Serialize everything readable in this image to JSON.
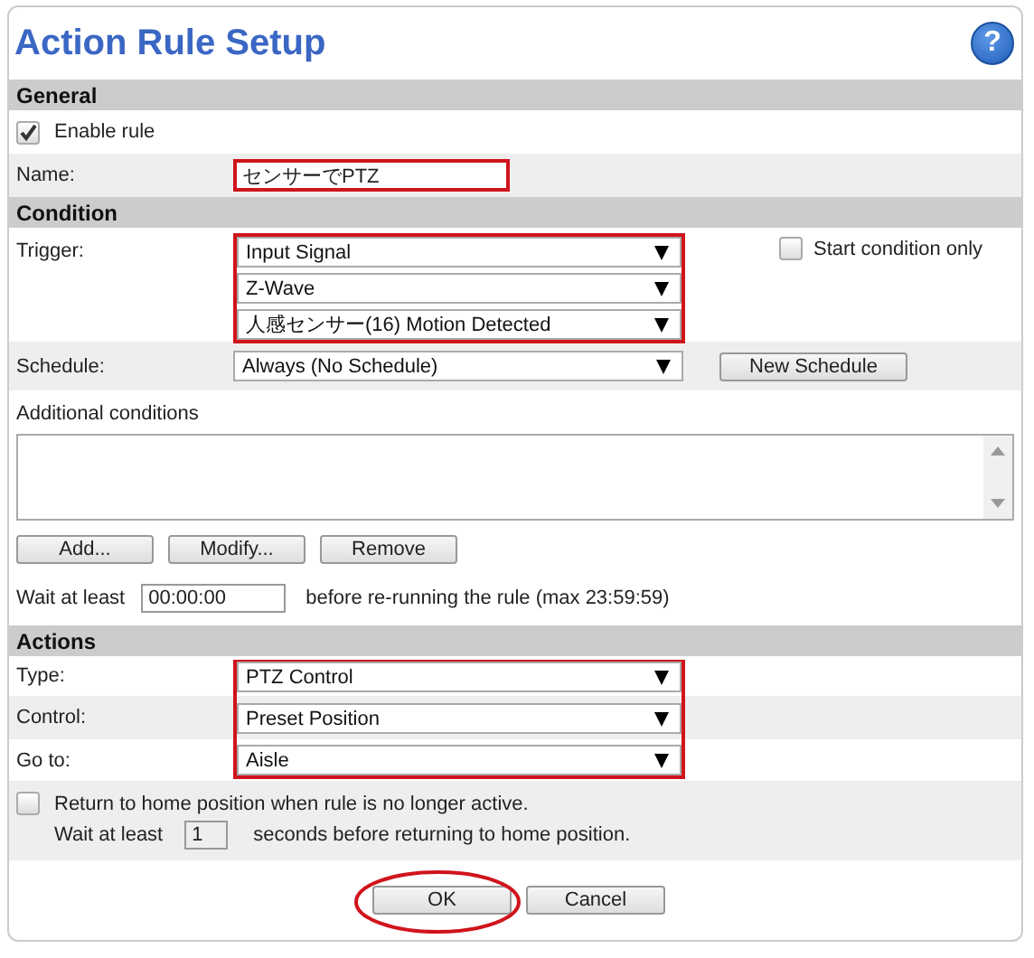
{
  "title": "Action Rule Setup",
  "help_icon": "?",
  "general": {
    "heading": "General",
    "enable_rule": {
      "label": "Enable rule",
      "checked": true
    },
    "name": {
      "label": "Name:",
      "value": "センサーでPTZ",
      "highlighted": true
    }
  },
  "condition": {
    "heading": "Condition",
    "trigger": {
      "label": "Trigger:",
      "highlighted": true,
      "selects": [
        "Input Signal",
        "Z-Wave",
        "人感センサー(16) Motion Detected"
      ]
    },
    "start_condition_only": {
      "label": "Start condition only",
      "checked": false
    },
    "schedule": {
      "label": "Schedule:",
      "value": "Always (No Schedule)",
      "button": "New Schedule"
    },
    "additional_conditions": {
      "label": "Additional conditions",
      "buttons": [
        "Add...",
        "Modify...",
        "Remove"
      ]
    },
    "wait": {
      "label": "Wait at least",
      "value": "00:00:00",
      "suffix": "before re-running the rule (max 23:59:59)"
    }
  },
  "actions": {
    "heading": "Actions",
    "highlighted": true,
    "rows": [
      {
        "label": "Type:",
        "value": "PTZ Control"
      },
      {
        "label": "Control:",
        "value": "Preset Position"
      },
      {
        "label": "Go to:",
        "value": "Aisle"
      }
    ],
    "return_home": {
      "label": "Return to home position when rule is no longer active.",
      "checked": false,
      "wait_label": "Wait at least",
      "wait_value": "1",
      "wait_suffix": "seconds before returning to home position."
    }
  },
  "buttons": [
    {
      "label": "OK",
      "highlighted": true
    },
    {
      "label": "Cancel",
      "highlighted": false
    }
  ]
}
